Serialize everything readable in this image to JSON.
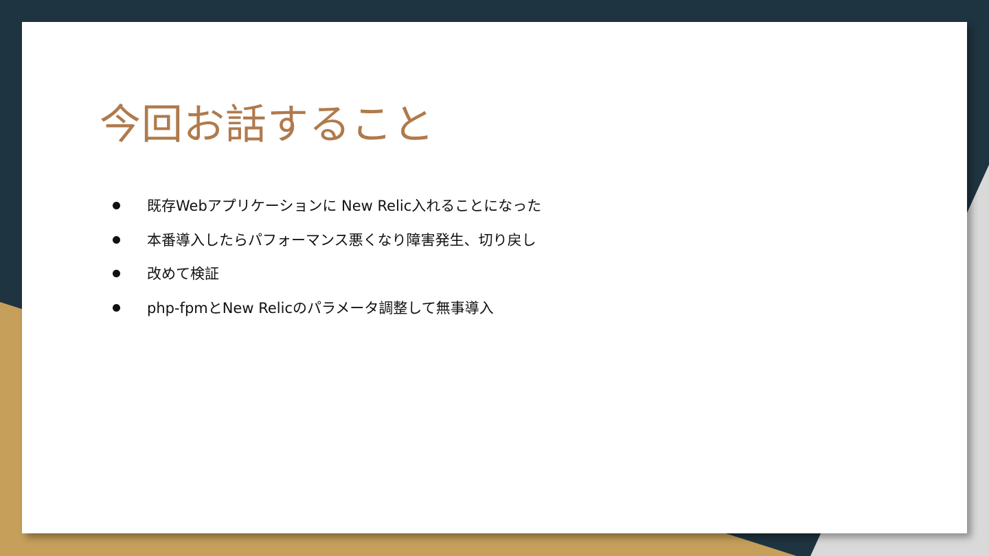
{
  "slide": {
    "title": "今回お話すること",
    "bullets": [
      "既存Webアプリケーションに New Relic入れることになった",
      "本番導入したらパフォーマンス悪くなり障害発生、切り戻し",
      "改めて検証",
      "php-fpmとNew Relicのパラメータ調整して無事導入"
    ]
  },
  "colors": {
    "navy": "#1f3441",
    "gold": "#c6a05a",
    "gray": "#d9d9d9",
    "title": "#b07a4c",
    "text": "#111111"
  }
}
